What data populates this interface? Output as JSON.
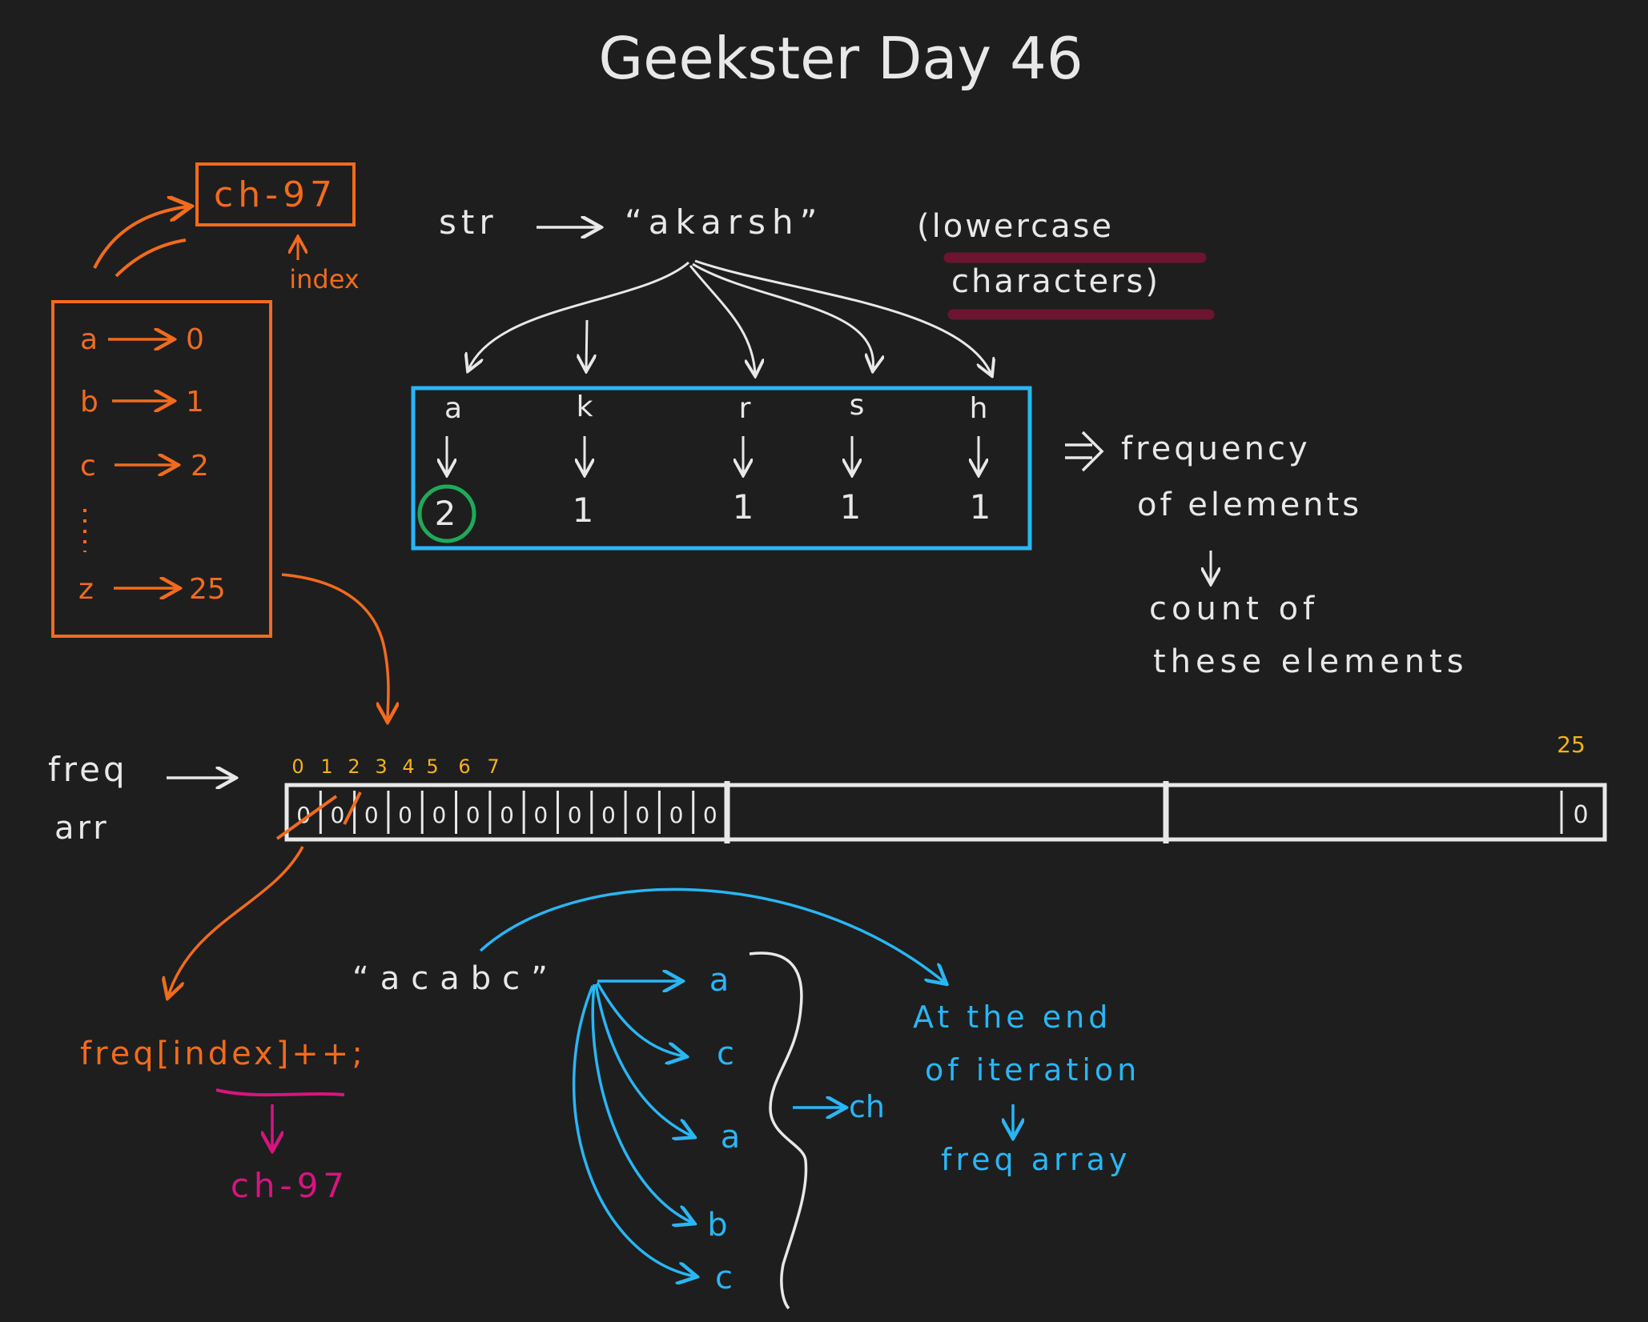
{
  "title": "Geekster Day 46",
  "colors": {
    "background": "#1e1e1e",
    "white": "#e8e8e8",
    "orange": "#f26b1d",
    "blue": "#29b6f6",
    "green": "#1faa59",
    "maroon": "#6b1530",
    "magenta": "#d6157f",
    "yellow": "#f5b21a"
  },
  "mapping": {
    "formula": "ch-97",
    "formula_label": "index",
    "rows": [
      {
        "char": "a",
        "index": "0"
      },
      {
        "char": "b",
        "index": "1"
      },
      {
        "char": "c",
        "index": "2"
      },
      {
        "char": "z",
        "index": "25"
      }
    ]
  },
  "string_example": {
    "label": "str",
    "value": "“akarsh”",
    "note_line1": "(lowercase",
    "note_line2": "characters)",
    "chars": [
      "a",
      "k",
      "r",
      "s",
      "h"
    ],
    "counts": [
      "2",
      "1",
      "1",
      "1",
      "1"
    ]
  },
  "frequency_note": {
    "line1": "frequency",
    "line2": "of elements",
    "line3": "count of",
    "line4": "these elements"
  },
  "freq_array": {
    "label_line1": "freq",
    "label_line2": "arr",
    "indices": [
      "0",
      "1",
      "2",
      "3",
      "4",
      "5",
      "6",
      "7"
    ],
    "last_index": "25",
    "cells": [
      "0",
      "0",
      "0",
      "0",
      "0",
      "0",
      "0",
      "0",
      "0",
      "0",
      "0",
      "0",
      "0"
    ],
    "last_cell": "0"
  },
  "increment": {
    "code": "freq[index]++;",
    "formula": "ch-97"
  },
  "iteration": {
    "string": "“acabc”",
    "chars": [
      "a",
      "c",
      "a",
      "b",
      "c"
    ],
    "ch_label": "ch",
    "note_line1": "At the end",
    "note_line2": "of iteration",
    "note_line3": "freq array"
  }
}
